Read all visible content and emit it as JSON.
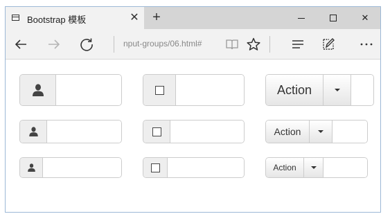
{
  "browser": {
    "tab_title": "Bootstrap 模板",
    "tab_close_glyph": "✕",
    "new_tab_glyph": "+",
    "address": "nput-groups/06.html#",
    "window_close_glyph": "✕",
    "icons": [
      "page-icon",
      "back-icon",
      "forward-icon",
      "refresh-icon",
      "reading-view-icon",
      "star-icon",
      "hub-icon",
      "web-note-icon",
      "more-icon"
    ]
  },
  "main": {
    "action_label": "Action",
    "rows": [
      "large",
      "default",
      "small"
    ]
  },
  "colors": {
    "addon_bg": "#eeeeee",
    "border": "#cccccc",
    "tab_active_bg": "#f2f2f2",
    "tabbar_bg": "#d5d5d5"
  }
}
